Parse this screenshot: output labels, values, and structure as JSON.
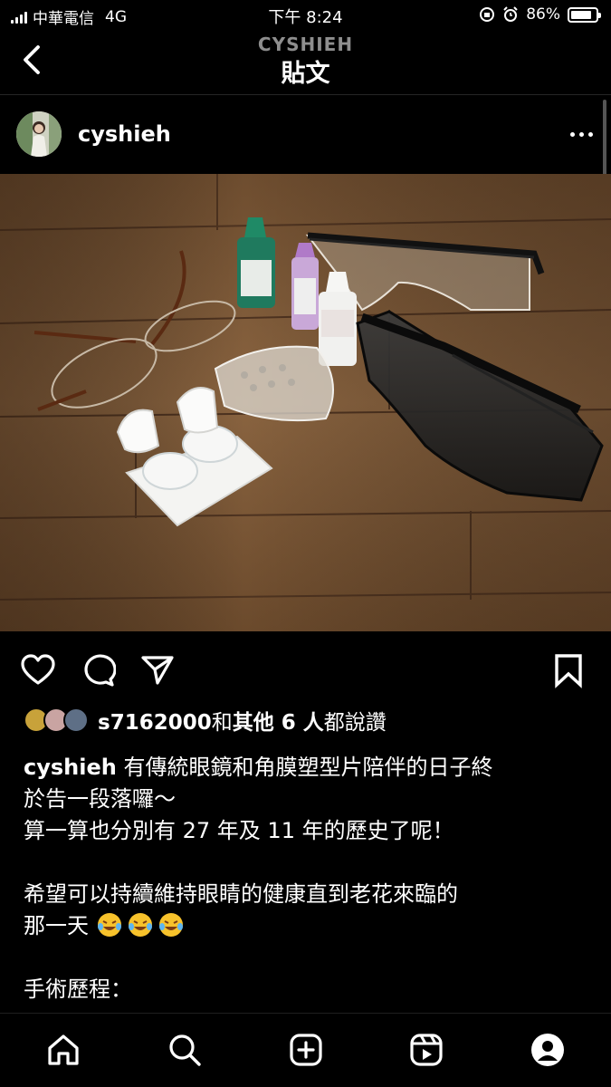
{
  "status_bar": {
    "carrier": "中華電信",
    "network": "4G",
    "time": "下午 8:24",
    "battery": "86%",
    "battery_level": 0.86
  },
  "header": {
    "account": "CYSHIEH",
    "title": "貼文"
  },
  "post": {
    "username": "cyshieh",
    "likes": {
      "liker": "s7162000",
      "joiner": "和",
      "others": "其他 6 人",
      "suffix": "都說讚"
    },
    "caption": {
      "username": "cyshieh",
      "line1": " 有傳統眼鏡和角膜塑型片陪伴的日子終",
      "line2": "於告一段落囉～",
      "line3": "算一算也分別有 27 年及 11 年的歷史了呢！",
      "line4": "希望可以持續維持眼睛的健康直到老花來臨的",
      "line5": "那一天",
      "line6": "手術歷程："
    },
    "emoji": "rolling-on-the-floor-laughing"
  },
  "icons": {
    "back": "chevron-left-icon",
    "more": "more-horizontal-icon",
    "like": "heart-icon",
    "comment": "comment-icon",
    "share": "send-icon",
    "save": "bookmark-icon",
    "home": "home-icon",
    "search": "search-icon",
    "create": "plus-square-icon",
    "reels": "reels-icon",
    "profile": "profile-icon"
  }
}
